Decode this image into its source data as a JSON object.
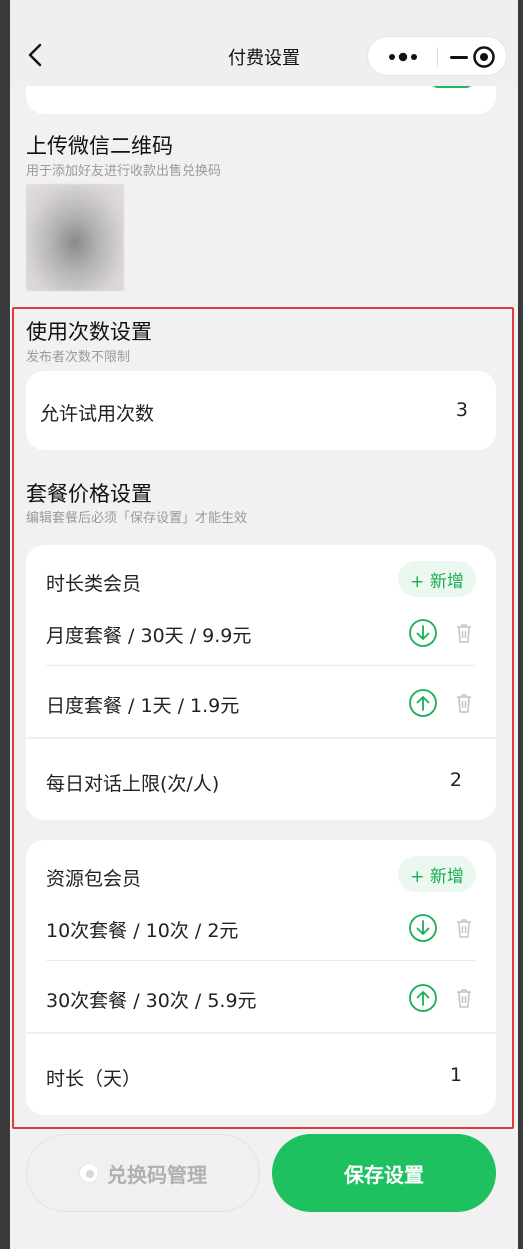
{
  "nav": {
    "title": "付费设置"
  },
  "wechat_qr": {
    "title": "上传微信二维码",
    "subtitle": "用于添加好友进行收款出售兑换码"
  },
  "usage": {
    "title": "使用次数设置",
    "subtitle": "发布者次数不限制",
    "trial_label": "允许试用次数",
    "trial_value": "3"
  },
  "pricing": {
    "title": "套餐价格设置",
    "subtitle": "编辑套餐后必须「保存设置」才能生效"
  },
  "duration_group": {
    "title": "时长类会员",
    "add_label": "+ 新增",
    "plans": [
      {
        "label": "月度套餐 / 30天 / 9.9元",
        "arrow": "down"
      },
      {
        "label": "日度套餐 / 1天 / 1.9元",
        "arrow": "up"
      }
    ],
    "limit_label": "每日对话上限(次/人)",
    "limit_value": "2"
  },
  "resource_group": {
    "title": "资源包会员",
    "add_label": "+ 新增",
    "plans": [
      {
        "label": "10次套餐 / 10次 / 2元",
        "arrow": "down"
      },
      {
        "label": "30次套餐 / 30次 / 5.9元",
        "arrow": "up"
      }
    ],
    "duration_label": "时长（天）",
    "duration_value": "1"
  },
  "footer": {
    "redeem_label": "兑换码管理",
    "save_label": "保存设置"
  },
  "colors": {
    "accent": "#1ec060",
    "highlight_border": "#e23a3a",
    "add_bg": "#eaf8ef"
  }
}
